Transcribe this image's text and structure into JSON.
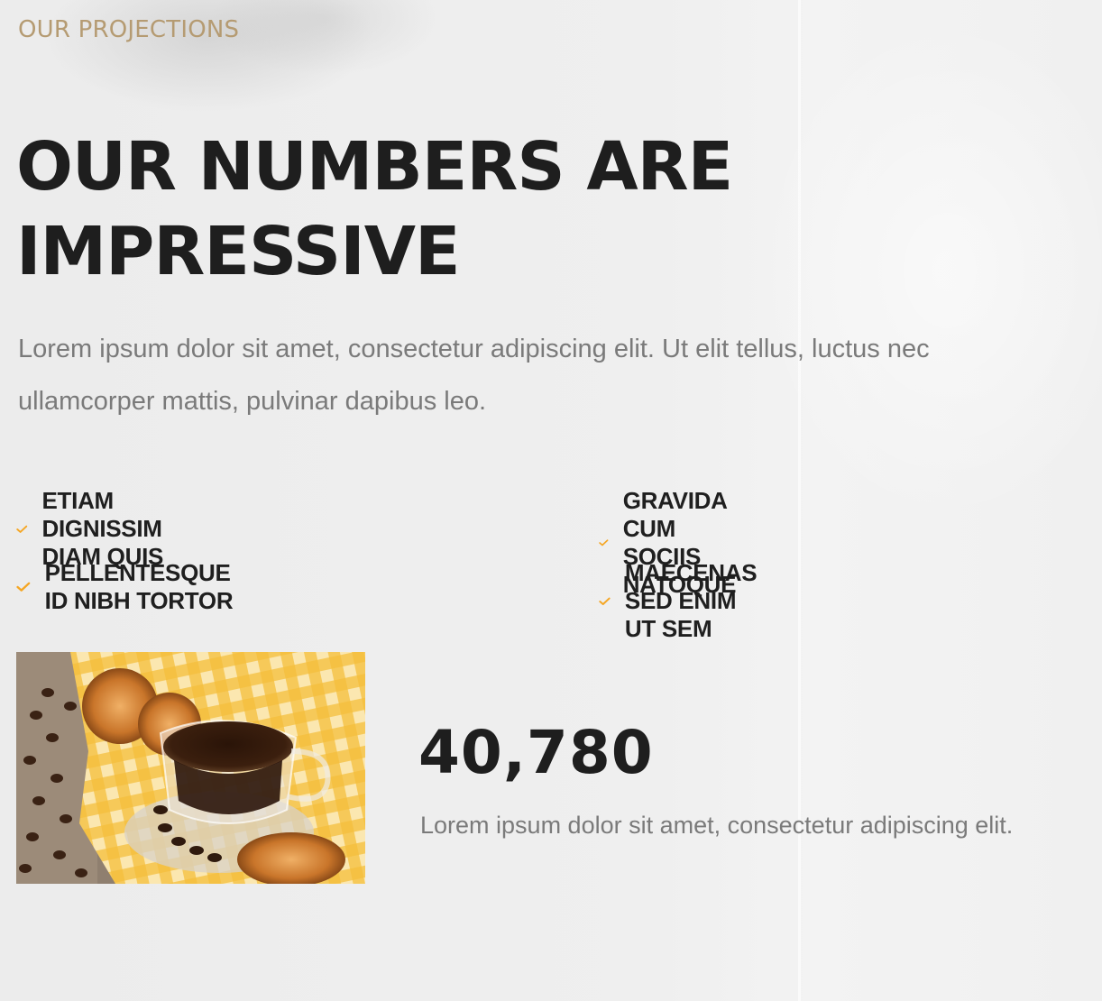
{
  "section": {
    "eyebrow": "OUR PROJECTIONS",
    "heading_line1": "OUR NUMBERS ARE",
    "heading_line2": "IMPRESSIVE",
    "intro": "Lorem ipsum dolor sit amet, consectetur adipiscing elit. Ut elit tellus, luctus nec ullamcorper mattis, pulvinar dapibus leo."
  },
  "features": [
    {
      "label": "ETIAM DIGNISSIM DIAM QUIS",
      "icon": "check-icon"
    },
    {
      "label": "GRAVIDA CUM SOCIIS NATOQUE",
      "icon": "check-icon"
    },
    {
      "label": "PELLENTESQUE ID NIBH TORTOR",
      "icon": "check-icon"
    },
    {
      "label": "MAECENAS SED ENIM UT SEM",
      "icon": "check-icon"
    }
  ],
  "stat": {
    "number": "40,780",
    "description": "Lorem ipsum dolor sit amet, consectetur adipiscing elit."
  },
  "colors": {
    "accent": "#f5a623",
    "eyebrow": "#b59b72",
    "heading": "#1e1e1e",
    "body": "#7a7a7a",
    "background": "#eeeeee"
  }
}
